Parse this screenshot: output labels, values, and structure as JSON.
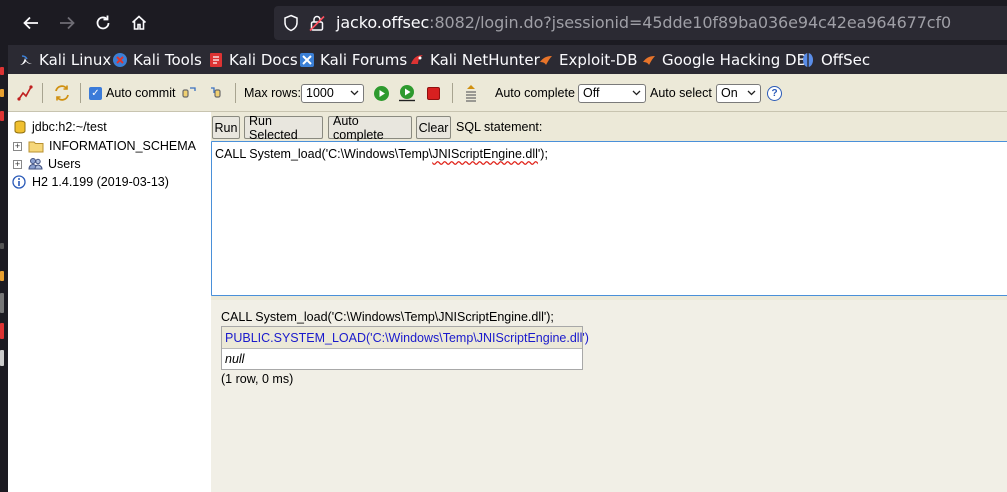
{
  "browser": {
    "url_host": "jacko.offsec",
    "url_rest": ":8082/login.do?jsessionid=45dde10f89ba036e94c42ea964677cf0",
    "bookmarks": [
      {
        "label": "Kali Linux",
        "icon": "kali-dragon-icon",
        "color": "#3b7fd6"
      },
      {
        "label": "Kali Tools",
        "icon": "kali-tools-icon",
        "color": "#e0342e"
      },
      {
        "label": "Kali Docs",
        "icon": "kali-docs-icon",
        "color": "#d33"
      },
      {
        "label": "Kali Forums",
        "icon": "kali-forums-icon",
        "color": "#3b7fd6"
      },
      {
        "label": "Kali NetHunter",
        "icon": "nethunter-icon",
        "color": "#d33"
      },
      {
        "label": "Exploit-DB",
        "icon": "exploit-db-icon",
        "color": "#e8742a"
      },
      {
        "label": "Google Hacking DB",
        "icon": "ghdb-icon",
        "color": "#e8742a"
      },
      {
        "label": "OffSec",
        "icon": "offsec-icon",
        "color": "#5a8de8"
      }
    ]
  },
  "toolbar": {
    "auto_commit_label": "Auto commit",
    "max_rows_label": "Max rows:",
    "max_rows_value": "1000",
    "auto_complete_label": "Auto complete",
    "auto_complete_value": "Off",
    "auto_select_label": "Auto select",
    "auto_select_value": "On",
    "help_symbol": "?"
  },
  "tree": {
    "connection": "jdbc:h2:~/test",
    "schema": "INFORMATION_SCHEMA",
    "users": "Users",
    "version": "H2 1.4.199 (2019-03-13)",
    "expand_symbol": "+"
  },
  "query": {
    "run_label": "Run",
    "run_selected_label": "Run Selected",
    "auto_complete_label": "Auto complete",
    "clear_label": "Clear",
    "sql_label": "SQL statement:",
    "sql_prefix": "CALL System_load('C:\\Windows\\Temp\\",
    "sql_misspelled": "JNIScriptEngine.dll",
    "sql_suffix": "');"
  },
  "result": {
    "statement": "CALL System_load('C:\\Windows\\Temp\\JNIScriptEngine.dll');",
    "column_header": "PUBLIC.SYSTEM_LOAD('C:\\Windows\\Temp\\JNIScriptEngine.dll')",
    "value": "null",
    "row_count": "(1 row, 0 ms)"
  }
}
